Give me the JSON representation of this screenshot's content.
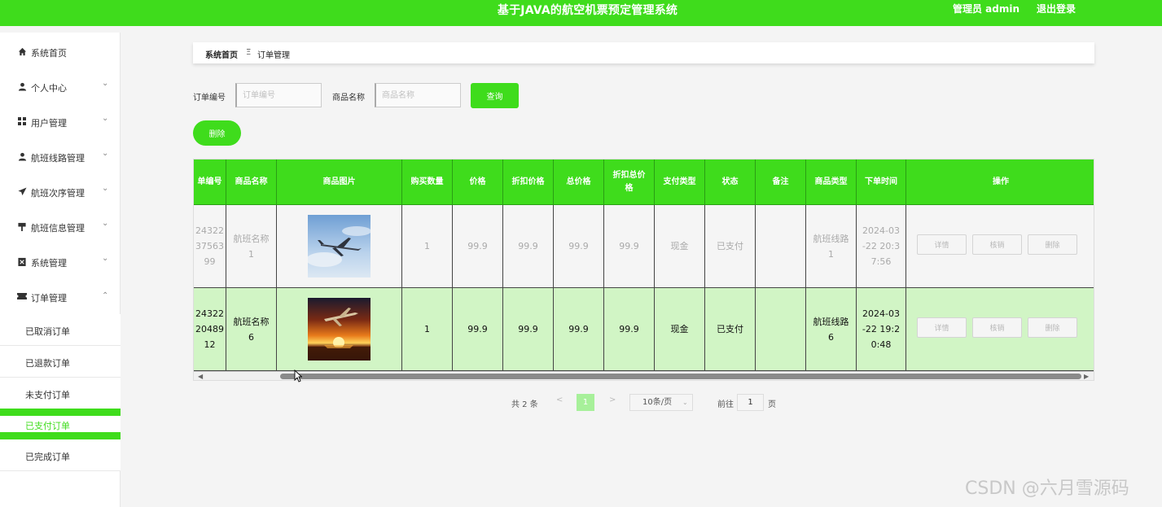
{
  "header": {
    "title": "基于JAVA的航空机票预定管理系统",
    "admin": "管理员 admin",
    "logout": "退出登录"
  },
  "sidebar": {
    "items": [
      {
        "label": "系统首页",
        "icon": "home-icon",
        "expandable": false
      },
      {
        "label": "个人中心",
        "icon": "user-icon",
        "expandable": true
      },
      {
        "label": "用户管理",
        "icon": "grid-icon",
        "expandable": true
      },
      {
        "label": "航班线路管理",
        "icon": "user-icon",
        "expandable": true
      },
      {
        "label": "航班次序管理",
        "icon": "send-icon",
        "expandable": true
      },
      {
        "label": "航班信息管理",
        "icon": "flag-icon",
        "expandable": true
      },
      {
        "label": "系统管理",
        "icon": "delete-icon",
        "expandable": true
      },
      {
        "label": "订单管理",
        "icon": "ticket-icon",
        "expandable": true,
        "expanded": true
      }
    ],
    "sub_items": [
      {
        "label": "已取消订单"
      },
      {
        "label": "已退款订单"
      },
      {
        "label": "未支付订单"
      },
      {
        "label": "已支付订单",
        "active": true
      },
      {
        "label": "已完成订单"
      }
    ]
  },
  "breadcrumb": {
    "home": "系统首页",
    "separator": "Ξ",
    "current": "订单管理"
  },
  "search": {
    "order_label": "订单编号",
    "order_placeholder": "订单编号",
    "order_value": "",
    "goods_label": "商品名称",
    "goods_placeholder": "商品名称",
    "goods_value": "",
    "query_button": "查询",
    "delete_button": "删除"
  },
  "table": {
    "columns": [
      "单编号",
      "商品名称",
      "商品图片",
      "购买数量",
      "价格",
      "折扣价格",
      "总价格",
      "折扣总价格",
      "支付类型",
      "状态",
      "备注",
      "商品类型",
      "下单时间",
      "操作"
    ],
    "rows": [
      {
        "order_no": "24322 37563 99",
        "goods_name": "航班名称 1",
        "image": "plane-sky-image",
        "qty": "1",
        "price": "99.9",
        "discount_price": "99.9",
        "total": "99.9",
        "discount_total": "99.9",
        "pay_type": "现金",
        "status": "已支付",
        "remark": "",
        "goods_type": "航班线路 1",
        "order_time": "2024-03 -22 20:3 7:56"
      },
      {
        "order_no": "24322 20489 12",
        "goods_name": "航班名称 6",
        "image": "plane-sunset-image",
        "qty": "1",
        "price": "99.9",
        "discount_price": "99.9",
        "total": "99.9",
        "discount_total": "99.9",
        "pay_type": "现金",
        "status": "已支付",
        "remark": "",
        "goods_type": "航班线路 6",
        "order_time": "2024-03 -22 19:2 0:48"
      }
    ],
    "ops": {
      "detail": "详情",
      "verify": "核销",
      "delete": "删除"
    }
  },
  "pagination": {
    "total": "共 2 条",
    "prev": "<",
    "current": "1",
    "next": ">",
    "page_size": "10条/页",
    "goto_label": "前往",
    "goto_value": "1",
    "page_unit": "页"
  },
  "watermark": "CSDN @六月雪源码",
  "colors": {
    "brand": "#3fdc1c",
    "highlight_row": "#d1f5c5"
  }
}
